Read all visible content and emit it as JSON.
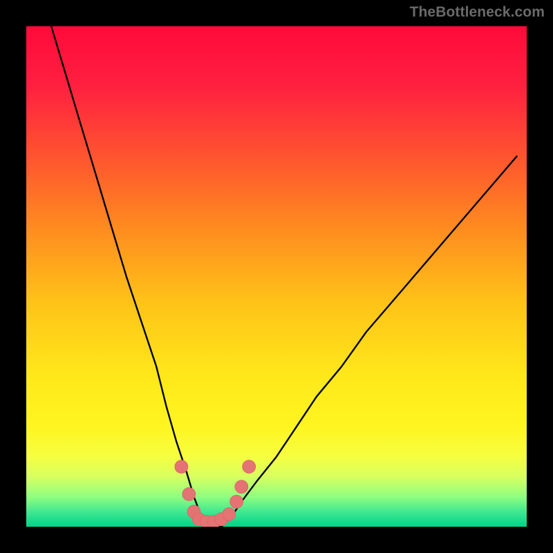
{
  "watermark": "TheBottleneck.com",
  "chart_data": {
    "type": "line",
    "title": "",
    "xlabel": "",
    "ylabel": "",
    "xlim": [
      0,
      100
    ],
    "ylim": [
      0,
      100
    ],
    "legend": false,
    "grid": false,
    "background": {
      "type": "vertical-gradient",
      "stops": [
        {
          "pos": 0.0,
          "color": "#ff0a3a"
        },
        {
          "pos": 0.12,
          "color": "#ff2040"
        },
        {
          "pos": 0.25,
          "color": "#ff5030"
        },
        {
          "pos": 0.4,
          "color": "#ff8a20"
        },
        {
          "pos": 0.55,
          "color": "#ffc218"
        },
        {
          "pos": 0.7,
          "color": "#ffe81a"
        },
        {
          "pos": 0.8,
          "color": "#fff520"
        },
        {
          "pos": 0.86,
          "color": "#f5ff40"
        },
        {
          "pos": 0.9,
          "color": "#d8ff60"
        },
        {
          "pos": 0.94,
          "color": "#90ff80"
        },
        {
          "pos": 0.97,
          "color": "#40e890"
        },
        {
          "pos": 1.0,
          "color": "#00d488"
        }
      ]
    },
    "series": [
      {
        "name": "bottleneck-curve",
        "color": "#000000",
        "x": [
          5,
          8,
          11,
          14,
          17,
          20,
          23,
          26,
          28,
          30,
          32,
          33.5,
          35,
          37,
          39,
          41,
          43,
          46,
          50,
          54,
          58,
          63,
          68,
          74,
          80,
          86,
          92,
          98
        ],
        "values": [
          100,
          90,
          80,
          70,
          60,
          50,
          41,
          32,
          24,
          17,
          11,
          6,
          2,
          0,
          0,
          2,
          5,
          9,
          14,
          20,
          26,
          32,
          39,
          46,
          53,
          60,
          67,
          74
        ]
      }
    ],
    "markers": {
      "name": "highlight-points",
      "color": "#e57373",
      "stroke": "#d86a6a",
      "radius_pct": 1.3,
      "points": [
        {
          "x": 31.0,
          "y": 12.0
        },
        {
          "x": 32.5,
          "y": 6.5
        },
        {
          "x": 33.5,
          "y": 3.0
        },
        {
          "x": 34.5,
          "y": 1.5
        },
        {
          "x": 36.0,
          "y": 1.0
        },
        {
          "x": 37.5,
          "y": 1.0
        },
        {
          "x": 39.0,
          "y": 1.5
        },
        {
          "x": 40.5,
          "y": 2.5
        },
        {
          "x": 42.0,
          "y": 5.0
        },
        {
          "x": 43.0,
          "y": 8.0
        },
        {
          "x": 44.5,
          "y": 12.0
        }
      ]
    }
  }
}
